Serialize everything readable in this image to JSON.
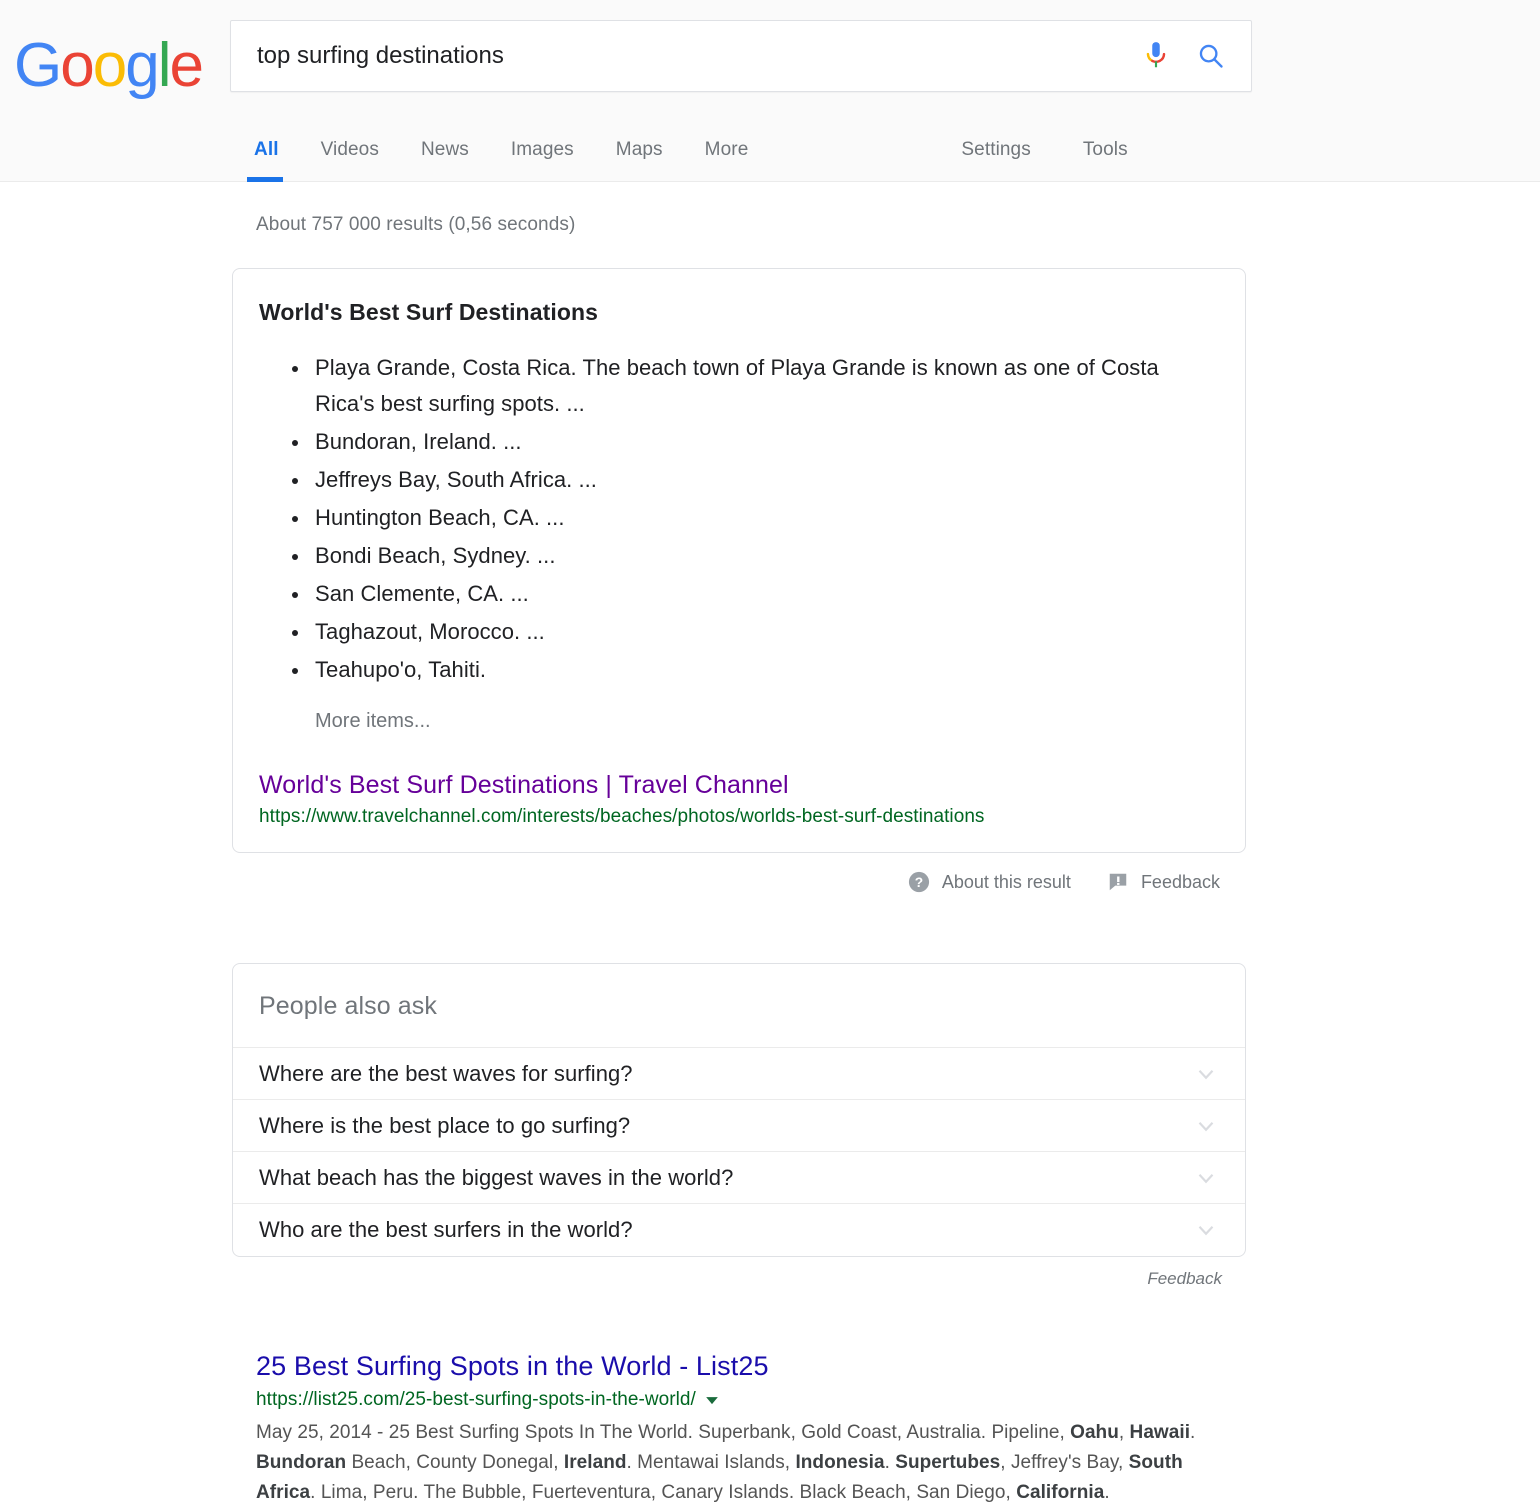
{
  "brand": {
    "logo_text": "Google",
    "logo_colors": [
      "#4285f4",
      "#ea4335",
      "#fbbc05",
      "#4285f4",
      "#34a853",
      "#ea4335"
    ],
    "accent_blue": "#1a73e8",
    "link_blue": "#1a0dab",
    "visited_purple": "#660099",
    "url_green": "#006621"
  },
  "search": {
    "query": "top surfing destinations",
    "placeholder": "Search",
    "mic_icon": "microphone-icon",
    "search_icon": "search-icon"
  },
  "nav": {
    "tabs": [
      {
        "label": "All",
        "active": true
      },
      {
        "label": "Videos",
        "active": false
      },
      {
        "label": "News",
        "active": false
      },
      {
        "label": "Images",
        "active": false
      },
      {
        "label": "Maps",
        "active": false
      },
      {
        "label": "More",
        "active": false
      }
    ],
    "tools": [
      {
        "label": "Settings"
      },
      {
        "label": "Tools"
      }
    ]
  },
  "results_stats": "About 757 000 results (0,56 seconds)",
  "featured_snippet": {
    "title": "World's Best Surf Destinations",
    "items": [
      "Playa Grande, Costa Rica. The beach town of Playa Grande is known as one of Costa Rica's best surfing spots. ...",
      "Bundoran, Ireland. ...",
      "Jeffreys Bay, South Africa. ...",
      "Huntington Beach, CA. ...",
      "Bondi Beach, Sydney. ...",
      "San Clemente, CA. ...",
      "Taghazout, Morocco. ...",
      "Teahupo'o, Tahiti."
    ],
    "more_items_label": "More items...",
    "source_title": "World's Best Surf Destinations | Travel Channel",
    "source_url": "https://www.travelchannel.com/interests/beaches/photos/worlds-best-surf-destinations"
  },
  "about_row": {
    "about_label": "About this result",
    "about_icon": "help-circle-icon",
    "feedback_label": "Feedback",
    "feedback_icon": "feedback-flag-icon"
  },
  "people_also_ask": {
    "header": "People also ask",
    "questions": [
      "Where are the best waves for surfing?",
      "Where is the best place to go surfing?",
      "What beach has the biggest waves in the world?",
      "Who are the best surfers in the world?"
    ],
    "expand_icon": "chevron-down-icon",
    "feedback_label": "Feedback"
  },
  "organic_results": [
    {
      "title": "25 Best Surfing Spots in the World - List25",
      "url": "https://list25.com/25-best-surfing-spots-in-the-world/",
      "url_dropdown_icon": "caret-down-icon",
      "date": "May 25, 2014",
      "snippet_segments": [
        {
          "text": "May 25, 2014 - 25 Best Surfing Spots In The World. Superbank, Gold Coast, Australia. Pipeline, ",
          "bold": false
        },
        {
          "text": "Oahu",
          "bold": true
        },
        {
          "text": ", ",
          "bold": false
        },
        {
          "text": "Hawaii",
          "bold": true
        },
        {
          "text": ". ",
          "bold": false
        },
        {
          "text": "Bundoran",
          "bold": true
        },
        {
          "text": " Beach, County Donegal, ",
          "bold": false
        },
        {
          "text": "Ireland",
          "bold": true
        },
        {
          "text": ". Mentawai Islands, ",
          "bold": false
        },
        {
          "text": "Indonesia",
          "bold": true
        },
        {
          "text": ". ",
          "bold": false
        },
        {
          "text": "Supertubes",
          "bold": true
        },
        {
          "text": ", Jeffrey's Bay, ",
          "bold": false
        },
        {
          "text": "South Africa",
          "bold": true
        },
        {
          "text": ". Lima, Peru. The Bubble, Fuerteventura, Canary Islands. Black Beach, San Diego, ",
          "bold": false
        },
        {
          "text": "California",
          "bold": true
        },
        {
          "text": ".",
          "bold": false
        }
      ]
    }
  ]
}
